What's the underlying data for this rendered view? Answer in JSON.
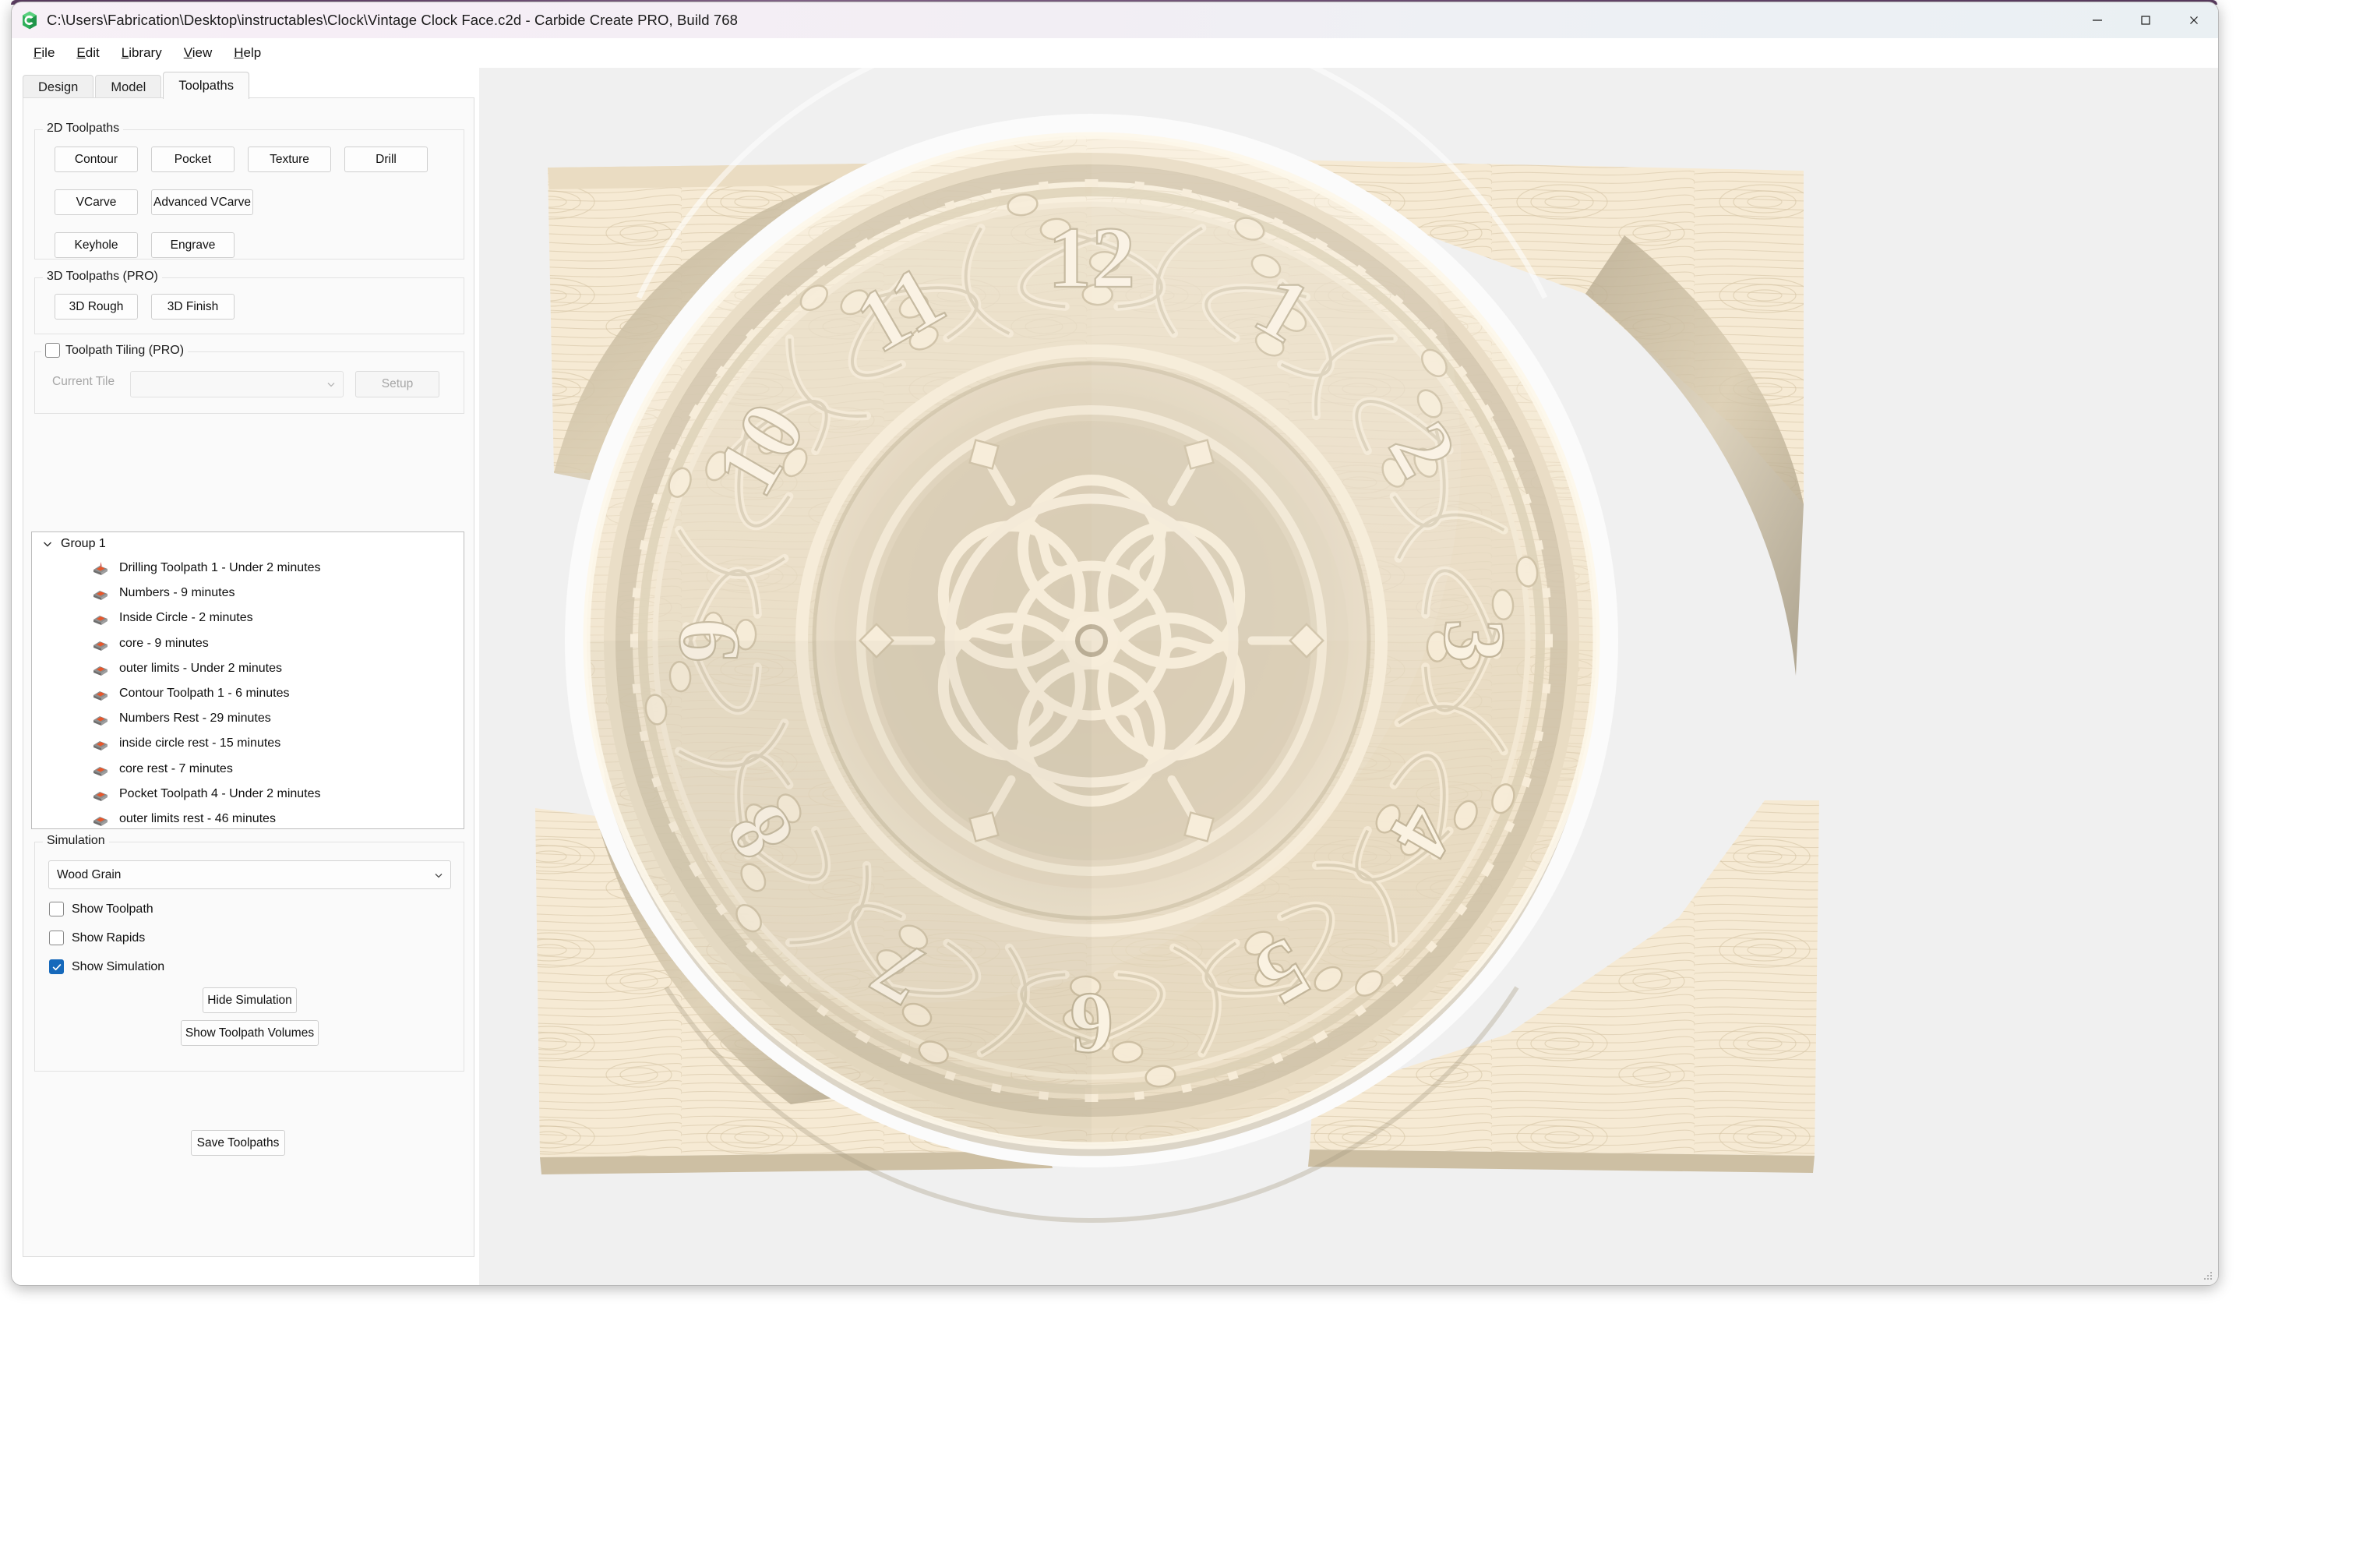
{
  "window": {
    "title": "C:\\Users\\Fabrication\\Desktop\\instructables\\Clock\\Vintage Clock Face.c2d - Carbide Create PRO, Build 768",
    "app_icon": "carbide-create-logo",
    "controls": {
      "minimize": "—",
      "maximize": "☐",
      "close": "✕"
    }
  },
  "menu": [
    {
      "label": "File",
      "mnemonic": "F"
    },
    {
      "label": "Edit",
      "mnemonic": "E"
    },
    {
      "label": "Library",
      "mnemonic": "L"
    },
    {
      "label": "View",
      "mnemonic": "V"
    },
    {
      "label": "Help",
      "mnemonic": "H"
    }
  ],
  "tabs": [
    {
      "label": "Design",
      "active": false
    },
    {
      "label": "Model",
      "active": false
    },
    {
      "label": "Toolpaths",
      "active": true
    }
  ],
  "toolpaths_2d": {
    "title": "2D Toolpaths",
    "buttons": [
      "Contour",
      "Pocket",
      "Texture",
      "Drill",
      "VCarve",
      "Advanced VCarve",
      "Keyhole",
      "Engrave"
    ]
  },
  "toolpaths_3d": {
    "title": "3D Toolpaths (PRO)",
    "buttons": [
      "3D Rough",
      "3D Finish"
    ]
  },
  "tiling": {
    "title": "Toolpath Tiling (PRO)",
    "checked": false,
    "current_tile_label": "Current Tile",
    "current_tile_value": "",
    "setup_label": "Setup"
  },
  "toolpath_tree": {
    "group_label": "Group 1",
    "expanded": true,
    "items": [
      {
        "label": "Drilling Toolpath 1 - Under 2 minutes",
        "icon": "toolpath-drill-icon"
      },
      {
        "label": "Numbers - 9 minutes",
        "icon": "toolpath-icon"
      },
      {
        "label": "Inside Circle - 2 minutes",
        "icon": "toolpath-icon"
      },
      {
        "label": "core - 9 minutes",
        "icon": "toolpath-icon"
      },
      {
        "label": "outer limits - Under 2 minutes",
        "icon": "toolpath-icon"
      },
      {
        "label": "Contour Toolpath 1 - 6 minutes",
        "icon": "toolpath-icon"
      },
      {
        "label": "Numbers Rest - 29 minutes",
        "icon": "toolpath-icon"
      },
      {
        "label": "inside circle rest - 15 minutes",
        "icon": "toolpath-icon"
      },
      {
        "label": "core rest - 7 minutes",
        "icon": "toolpath-icon"
      },
      {
        "label": "Pocket Toolpath 4 - Under 2 minutes",
        "icon": "toolpath-icon"
      },
      {
        "label": "outer limits rest - 46 minutes",
        "icon": "toolpath-icon"
      }
    ]
  },
  "simulation": {
    "title": "Simulation",
    "material_value": "Wood Grain",
    "checkboxes": [
      {
        "label": "Show Toolpath",
        "checked": false
      },
      {
        "label": "Show Rapids",
        "checked": false
      },
      {
        "label": "Show Simulation",
        "checked": true
      }
    ],
    "hide_simulation_label": "Hide Simulation",
    "show_volumes_label": "Show Toolpath Volumes"
  },
  "save_toolpaths_label": "Save Toolpaths",
  "viewport": {
    "name": "3d-simulation-viewport",
    "background": "#f0f0f0",
    "render": "vintage-clock-face-cnc-simulation",
    "clock_numerals": [
      "12",
      "1",
      "2",
      "3",
      "4",
      "5",
      "6",
      "7",
      "8",
      "9",
      "10",
      "11"
    ]
  },
  "colors": {
    "accent_checkbox": "#1669bb",
    "titlebar_gradient_start": "#f7f1f7",
    "titlebar_gradient_end": "#eaf0f3",
    "panel_bg": "#fafafa",
    "viewport_bg": "#f0f0f0",
    "wood_light": "#f5e8d2",
    "wood_mid": "#e3d6be",
    "wood_dark": "#cfc1a6"
  }
}
